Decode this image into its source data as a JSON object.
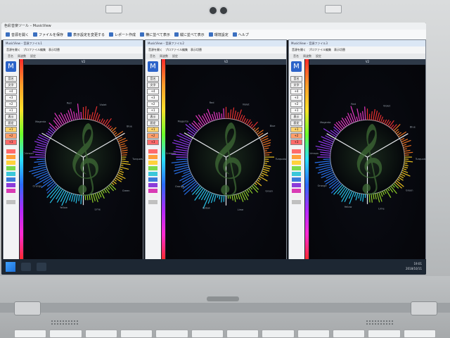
{
  "app_title": "色彩音楽ツール – MusicView",
  "toolbar": [
    {
      "label": "音源を開く",
      "icon": "folder-icon"
    },
    {
      "label": "ファイルを保存",
      "icon": "save-icon"
    },
    {
      "label": "表示設定を変更する",
      "icon": "settings-icon"
    },
    {
      "label": "レポート作成",
      "icon": "report-icon"
    },
    {
      "label": "横に並べて表示",
      "icon": "tile-horizontal-icon"
    },
    {
      "label": "縦に並べて表示",
      "icon": "tile-vertical-icon"
    },
    {
      "label": "環境設定",
      "icon": "gear-icon"
    },
    {
      "label": "ヘルプ",
      "icon": "help-icon"
    }
  ],
  "panels": [
    {
      "title": "MusicView – 音源ファイル1",
      "toolbar": [
        "音源を開く",
        "プロファイル編集",
        "表示切替"
      ],
      "menu": [
        "音名",
        "周波数",
        "設定"
      ],
      "view_label": "V2",
      "logo": "M"
    },
    {
      "title": "MusicView – 音源ファイル2",
      "toolbar": [
        "音源を開く",
        "プロファイル編集",
        "表示切替"
      ],
      "menu": [
        "音名",
        "周波数",
        "設定"
      ],
      "view_label": "V2",
      "logo": "M"
    },
    {
      "title": "MusicView – 音源ファイル3",
      "toolbar": [
        "音源を開く",
        "プロファイル編集",
        "表示切替"
      ],
      "menu": [
        "音名",
        "周波数",
        "設定"
      ],
      "view_label": "V2",
      "logo": "M"
    }
  ],
  "side_buttons": [
    "音名",
    "文字",
    "+4",
    "+3",
    "+2",
    "+1",
    "表示",
    "設定",
    "+1",
    "+2",
    "+3"
  ],
  "color_ring_labels": [
    "Red",
    "Violet",
    "Blue",
    "Turquoise",
    "Green",
    "Lime",
    "Yellow",
    "Orange",
    "Crimson",
    "Magenta"
  ],
  "tray": {
    "time": "19:01",
    "date": "2018/10/11"
  },
  "colors": {
    "accent": "#2b63c9",
    "plot_bg": "#06070c",
    "taskbar": "#1d2733"
  }
}
